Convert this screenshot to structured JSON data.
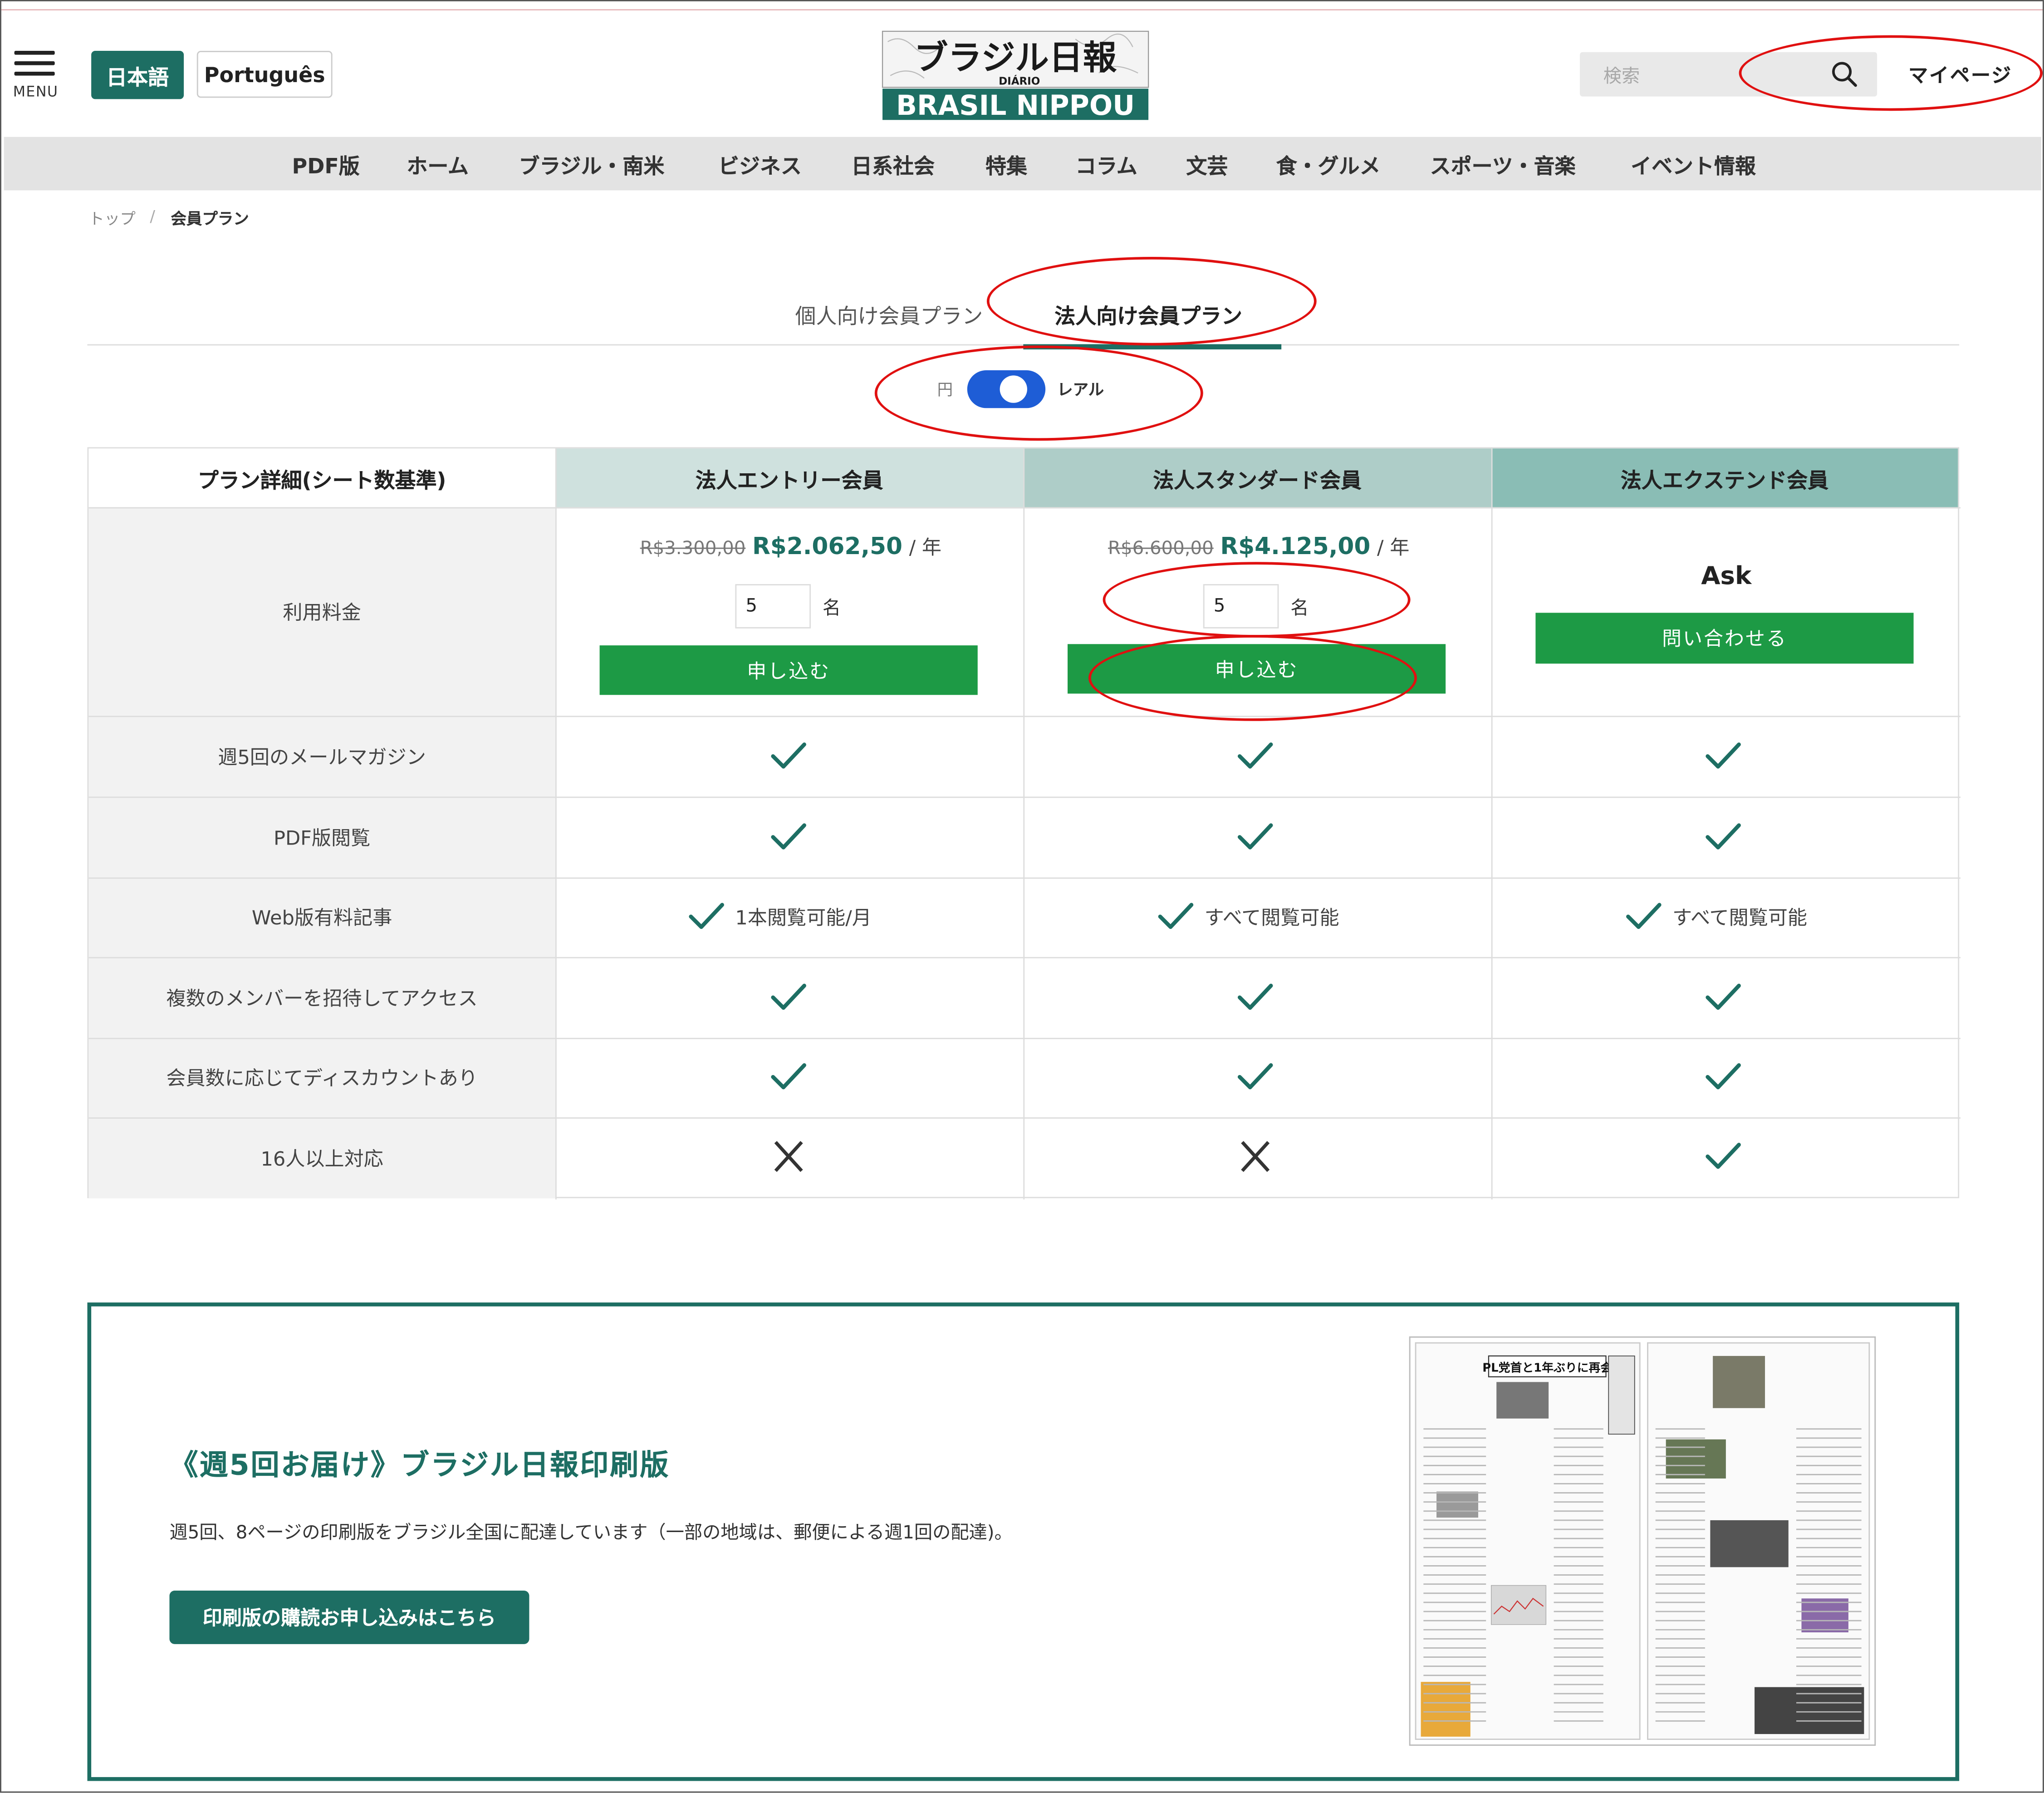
{
  "header": {
    "menu_label": "MENU",
    "lang_ja": "日本語",
    "lang_pt": "Português",
    "logo_top": "ブラジル日報",
    "logo_small": "DIÁRIO",
    "logo_bottom": "BRASIL NIPPOU",
    "search_placeholder": "検索",
    "mypage": "マイページ"
  },
  "nav": [
    "PDF版",
    "ホーム",
    "ブラジル・南米",
    "ビジネス",
    "日系社会",
    "特集",
    "コラム",
    "文芸",
    "食・グルメ",
    "スポーツ・音楽",
    "イベント情報"
  ],
  "breadcrumb": {
    "home": "トップ",
    "sep": "/",
    "current": "会員プラン"
  },
  "tabs": {
    "individual": "個人向け会員プラン",
    "corporate": "法人向け会員プラン"
  },
  "currency": {
    "left": "円",
    "right": "レアル",
    "selected": "レアル"
  },
  "plans": {
    "header_label": "プラン詳細(シート数基準)",
    "columns": [
      {
        "name": "法人エントリー会員",
        "header_color": "#cfe1de",
        "old_price": "R$3.300,00",
        "price": "R$2.062,50",
        "per": "/ 年",
        "quantity": "5",
        "unit": "名",
        "button": "申し込む"
      },
      {
        "name": "法人スタンダード会員",
        "header_color": "#aecdc8",
        "old_price": "R$6.600,00",
        "price": "R$4.125,00",
        "per": "/ 年",
        "quantity": "5",
        "unit": "名",
        "button": "申し込む"
      },
      {
        "name": "法人エクステンド会員",
        "header_color": "#8abdb5",
        "ask": "Ask",
        "button": "問い合わせる"
      }
    ],
    "fee_label": "利用料金",
    "features": [
      {
        "label": "週5回のメールマガジン",
        "values": [
          "check",
          "check",
          "check"
        ]
      },
      {
        "label": "PDF版閲覧",
        "values": [
          "check",
          "check",
          "check"
        ]
      },
      {
        "label": "Web版有料記事",
        "values": [
          "check",
          "check",
          "check"
        ],
        "notes": [
          "1本閲覧可能/月",
          "すべて閲覧可能",
          "すべて閲覧可能"
        ]
      },
      {
        "label": "複数のメンバーを招待してアクセス",
        "values": [
          "check",
          "check",
          "check"
        ]
      },
      {
        "label": "会員数に応じてディスカウントあり",
        "values": [
          "check",
          "check",
          "check"
        ]
      },
      {
        "label": "16人以上対応",
        "values": [
          "cross",
          "cross",
          "check"
        ]
      }
    ]
  },
  "promo": {
    "title": "《週5回お届け》ブラジル日報印刷版",
    "description": "週5回、8ページの印刷版をブラジル全国に配達しています（一部の地域は、郵便による週1回の配達)。",
    "button": "印刷版の購読お申し込みはこちら",
    "image_headline": "PL党首と1年ぶりに再会"
  },
  "colors": {
    "brand_green": "#1d6e63",
    "button_green": "#1d9a45",
    "toggle_blue": "#1e5dd6",
    "annotation_red": "#e01010"
  },
  "icons": {
    "menu": "hamburger-icon",
    "search": "search-icon",
    "check": "check-icon",
    "cross": "cross-icon"
  }
}
